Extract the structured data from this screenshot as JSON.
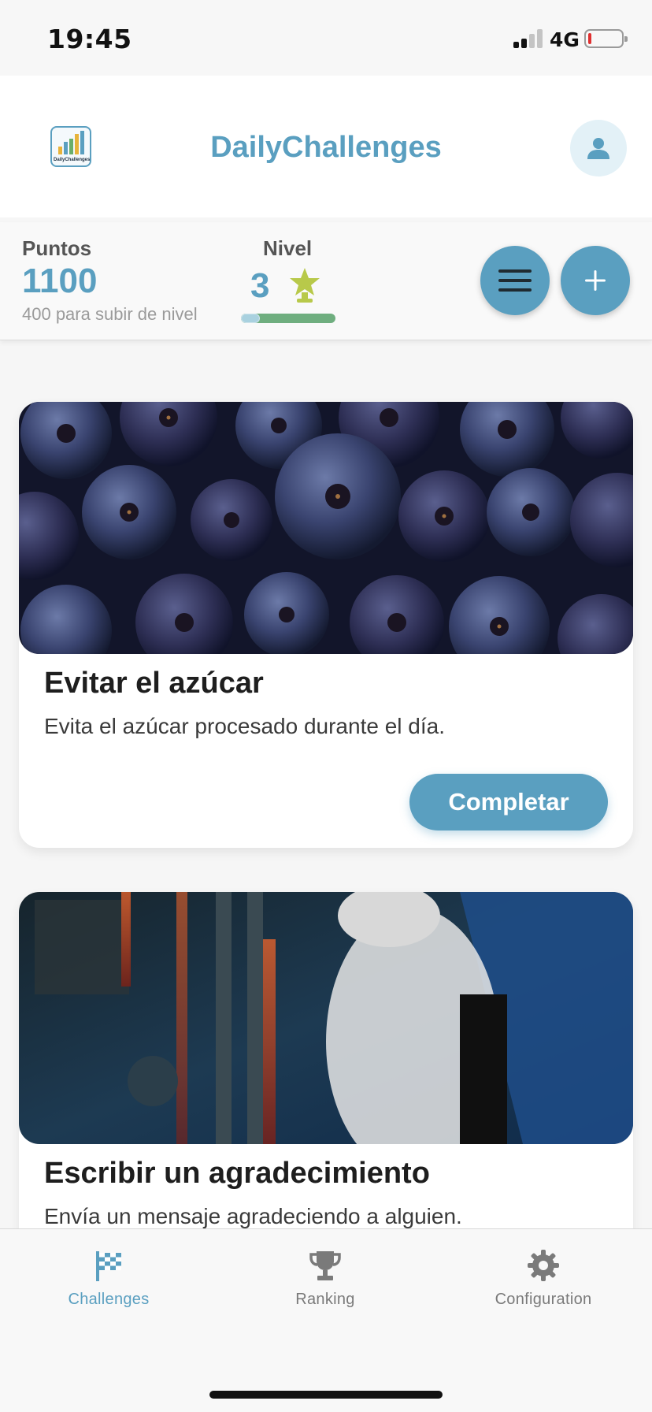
{
  "status_bar": {
    "time": "19:45",
    "network": "4G",
    "icons": [
      "signal-icon",
      "battery-icon"
    ]
  },
  "header": {
    "title": "DailyChallenges",
    "logo_text": "DailyChallenges",
    "logo_icon": "app-logo-icon",
    "profile_icon": "person-icon"
  },
  "stats": {
    "points_label": "Puntos",
    "points_value": "1100",
    "points_sub": "400 para subir de nivel",
    "level_label": "Nivel",
    "level_value": "3",
    "level_progress": 0.2,
    "level_icon": "star-trophy-icon",
    "menu_icon": "hamburger-icon",
    "add_icon": "plus-icon"
  },
  "challenges": [
    {
      "title": "Evitar el azúcar",
      "description": "Evita el azúcar procesado durante el día.",
      "button_label": "Completar",
      "image": "blueberries-photo"
    },
    {
      "title": "Escribir un agradecimiento",
      "description": "Envía un mensaje agradeciendo a alguien.",
      "image": "dj-photo"
    }
  ],
  "tabs": [
    {
      "label": "Challenges",
      "icon": "checkered-flag-icon",
      "active": true
    },
    {
      "label": "Ranking",
      "icon": "trophy-icon",
      "active": false
    },
    {
      "label": "Configuration",
      "icon": "gear-icon",
      "active": false
    }
  ],
  "colors": {
    "accent": "#5a9fc0",
    "accent_light": "#e3f1f7",
    "tab_inactive": "#7a7a7a",
    "star": "#b8c94a"
  }
}
